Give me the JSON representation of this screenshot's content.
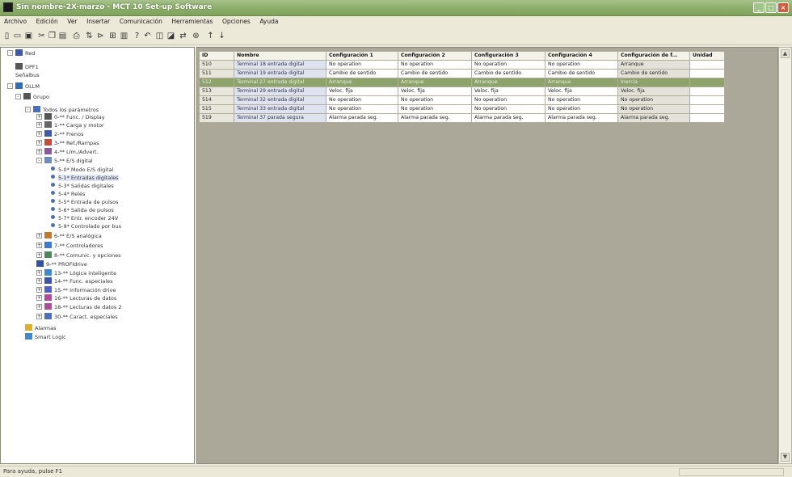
{
  "window": {
    "title": "Sin nombre-2X-marzo - MCT 10 Set-up Software",
    "controls": [
      "_",
      "□",
      "×"
    ]
  },
  "menu": [
    "Archivo",
    "Edición",
    "Ver",
    "Insertar",
    "Comunicación",
    "Herramientas",
    "Opciones",
    "Ayuda"
  ],
  "toolbar": [
    "new-icon",
    "open-icon",
    "save-icon",
    "cut-icon",
    "copy-icon",
    "paste-icon",
    "print-icon",
    "sort-icon",
    "filter-icon",
    "grid-icon",
    "columns-icon",
    "help-icon",
    "undo-icon",
    "read-icon",
    "write-icon",
    "connect-icon",
    "network-icon",
    "up-icon",
    "down-icon"
  ],
  "tree": [
    {
      "label": "Red",
      "depth": 0,
      "exp": "-",
      "icon": "network"
    },
    {
      "label": "DPF1",
      "depth": 1,
      "icon": "plug"
    },
    {
      "label": "Señalbus",
      "depth": 1,
      "icon": "none"
    },
    {
      "label": "OLLM",
      "depth": 0,
      "exp": "-",
      "icon": "globe"
    },
    {
      "label": "Grupo",
      "depth": 1,
      "exp": "-",
      "icon": "drive"
    },
    {
      "label": "Todos los parámetros",
      "depth": 2,
      "exp": "-",
      "icon": "list"
    },
    {
      "label": "0-** Func. / Display",
      "depth": 3,
      "exp": "+",
      "icon": "drive"
    },
    {
      "label": "1-** Carga y motor",
      "depth": 3,
      "exp": "+",
      "icon": "motor"
    },
    {
      "label": "2-** Frenos",
      "depth": 3,
      "exp": "+",
      "icon": "brake"
    },
    {
      "label": "3-** Ref./Rampas",
      "depth": 3,
      "exp": "+",
      "icon": "ramp"
    },
    {
      "label": "4-** Lím./Advert.",
      "depth": 3,
      "exp": "+",
      "icon": "limit"
    },
    {
      "label": "5-** E/S digital",
      "depth": 3,
      "exp": "-",
      "icon": "io"
    },
    {
      "label": "5-0* Modo E/S digital",
      "depth": 4,
      "icon": "dot"
    },
    {
      "label": "5-1* Entradas digitales",
      "depth": 4,
      "icon": "dot",
      "selected": true
    },
    {
      "label": "5-3* Salidas digitales",
      "depth": 4,
      "icon": "dot"
    },
    {
      "label": "5-4* Relés",
      "depth": 4,
      "icon": "dot"
    },
    {
      "label": "5-5* Entrada de pulsos",
      "depth": 4,
      "icon": "dot"
    },
    {
      "label": "5-6* Salida de pulsos",
      "depth": 4,
      "icon": "dot"
    },
    {
      "label": "5-7* Entr. encoder 24V",
      "depth": 4,
      "icon": "dot"
    },
    {
      "label": "5-9* Controlado por bus",
      "depth": 4,
      "icon": "dot"
    },
    {
      "label": "6-** E/S analógica",
      "depth": 3,
      "exp": "+",
      "icon": "analog"
    },
    {
      "label": "7-** Controladores",
      "depth": 3,
      "exp": "+",
      "icon": "ctrl"
    },
    {
      "label": "8-** Comunic. y opciones",
      "depth": 3,
      "exp": "+",
      "icon": "comm"
    },
    {
      "label": "9-** PROFIdrive",
      "depth": 3,
      "icon": "profi"
    },
    {
      "label": "13-** Lógica inteligente",
      "depth": 3,
      "exp": "+",
      "icon": "logic"
    },
    {
      "label": "14-** Func. especiales",
      "depth": 3,
      "exp": "+",
      "icon": "special"
    },
    {
      "label": "15-** Información drive",
      "depth": 3,
      "exp": "+",
      "icon": "info"
    },
    {
      "label": "16-** Lecturas de datos",
      "depth": 3,
      "exp": "+",
      "icon": "readout"
    },
    {
      "label": "18-** Lecturas de datos 2",
      "depth": 3,
      "exp": "+",
      "icon": "readout"
    },
    {
      "label": "30-** Caract. especiales",
      "depth": 3,
      "exp": "+",
      "icon": "list"
    },
    {
      "label": "Alarmas",
      "depth": 2,
      "icon": "alarm"
    },
    {
      "label": "Smart Logic",
      "depth": 2,
      "icon": "logic"
    }
  ],
  "grid": {
    "columns": [
      "ID",
      "Nombre",
      "Configuración 1",
      "Configuración 2",
      "Configuración 3",
      "Configuración 4",
      "Configuración de f...",
      "Unidad"
    ],
    "rows": [
      {
        "id": "510",
        "name": "Terminal 18 entrada digital",
        "c1": "No operation",
        "c2": "No operation",
        "c3": "No operation",
        "c4": "No operation",
        "def": "Arranque",
        "unit": ""
      },
      {
        "id": "511",
        "name": "Terminal 19 entrada digital",
        "c1": "Cambio de sentido",
        "c2": "Cambio de sentido",
        "c3": "Cambio de sentido",
        "c4": "Cambio de sentido",
        "def": "Cambio de sentido",
        "unit": ""
      },
      {
        "id": "512",
        "name": "Terminal 27 entrada digital",
        "c1": "Arranque",
        "c2": "Arranque",
        "c3": "Arranque",
        "c4": "Arranque",
        "def": "Inercia",
        "unit": "",
        "selected": true
      },
      {
        "id": "513",
        "name": "Terminal 29 entrada digital",
        "c1": "Veloc. fija",
        "c2": "Veloc. fija",
        "c3": "Veloc. fija",
        "c4": "Veloc. fija",
        "def": "Veloc. fija",
        "unit": ""
      },
      {
        "id": "514",
        "name": "Terminal 32 entrada digital",
        "c1": "No operation",
        "c2": "No operation",
        "c3": "No operation",
        "c4": "No operation",
        "def": "No operation",
        "unit": ""
      },
      {
        "id": "515",
        "name": "Terminal 33 entrada digital",
        "c1": "No operation",
        "c2": "No operation",
        "c3": "No operation",
        "c4": "No operation",
        "def": "No operation",
        "unit": ""
      },
      {
        "id": "519",
        "name": "Terminal 37 parada segura",
        "c1": "Alarma parada seg.",
        "c2": "Alarma parada seg.",
        "c3": "Alarma parada seg.",
        "c4": "Alarma parada seg.",
        "def": "Alarma parada seg.",
        "unit": ""
      }
    ]
  },
  "status": {
    "text": "Para ayuda, pulse F1"
  },
  "colors": {
    "titlebar": "#8faf6e",
    "selected_row": "#8da36b",
    "workspace": "#aca899"
  }
}
